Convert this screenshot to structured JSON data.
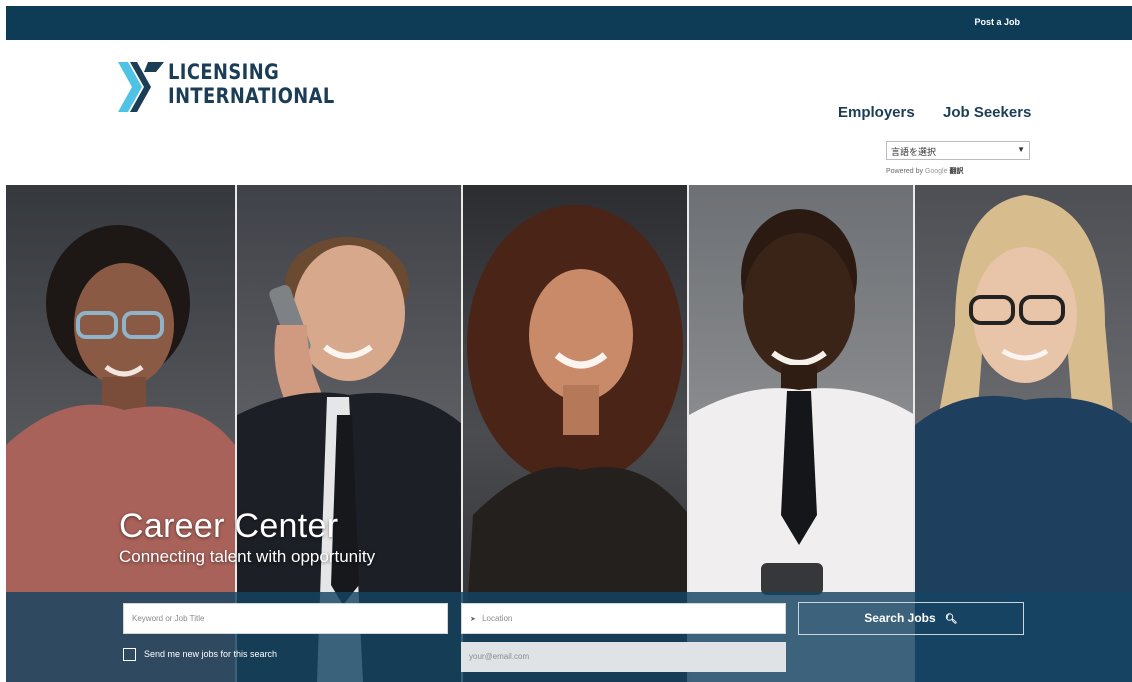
{
  "topbar": {
    "post_job_label": "Post a Job"
  },
  "logo": {
    "line1": "LICENSING",
    "line2": "INTERNATIONAL"
  },
  "nav": {
    "employers": "Employers",
    "job_seekers": "Job Seekers"
  },
  "translate": {
    "select_label": "言語を選択",
    "powered_by": "Powered by",
    "google": "Google",
    "translate": "翻訳"
  },
  "hero": {
    "title": "Career Center",
    "subtitle": "Connecting talent with opportunity"
  },
  "search": {
    "keyword_placeholder": "Keyword or Job Title",
    "location_placeholder": "Location",
    "email_placeholder": "your@email.com",
    "button_label": "Search Jobs",
    "alert_label": "Send me new jobs for this search"
  },
  "colors": {
    "navy": "#0e3b55",
    "logo_text": "#1b3d56",
    "logo_accent": "#4fc3e6",
    "band": "#144462"
  }
}
